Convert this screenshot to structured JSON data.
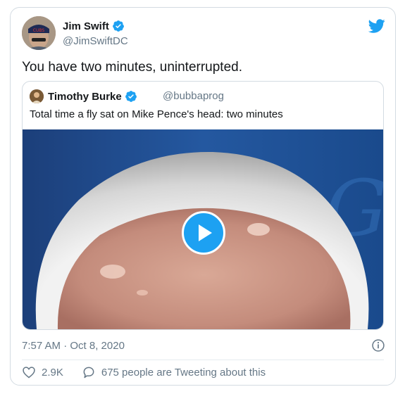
{
  "tweet": {
    "author": {
      "name": "Jim Swift",
      "handle": "@JimSwiftDC",
      "avatar": "avatar-icon",
      "verified": true
    },
    "text": "You have two minutes, uninterrupted.",
    "timestamp": "7:57 AM · Oct 8, 2020",
    "likes": "2.9K",
    "retweet_summary": "675 people are Tweeting about this",
    "quote": {
      "author": {
        "name": "Timothy Burke",
        "handle": "@bubbaprog",
        "verified": true
      },
      "text": "Total time a fly sat on Mike Pence's head: two minutes",
      "media": {
        "type": "video",
        "play_icon": "play-icon"
      }
    }
  },
  "icons": {
    "brand": "twitter-bird-icon",
    "verified": "verified-badge-icon",
    "info": "info-icon",
    "like": "heart-icon",
    "comment": "comment-icon"
  },
  "colors": {
    "accent": "#1da1f2",
    "text": "#14171a",
    "secondary": "#657786",
    "border": "#d3dbe2"
  }
}
